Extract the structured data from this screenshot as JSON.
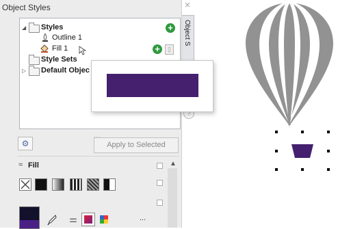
{
  "docker": {
    "title": "Object Styles",
    "close_glyph": "×",
    "vertical_tab": "Object S",
    "apply_button": "Apply to Selected",
    "grip": "...",
    "tree": {
      "styles": "Styles",
      "outline1": "Outline 1",
      "fill1": "Fill 1",
      "style_sets": "Style Sets",
      "default_objects": "Default Objec"
    },
    "fill_section": {
      "header": "Fill",
      "more": "..."
    }
  },
  "colors": {
    "swatch": "#44206e",
    "balloon_gray": "#929292",
    "basket": "#44206e",
    "add_green": "#2f9a3e"
  },
  "icons": [
    "plus-icon",
    "trash-icon",
    "outline-pen-icon",
    "fill-bucket-icon",
    "folder-icon",
    "eyedropper-icon",
    "settings-icon",
    "close-icon"
  ]
}
